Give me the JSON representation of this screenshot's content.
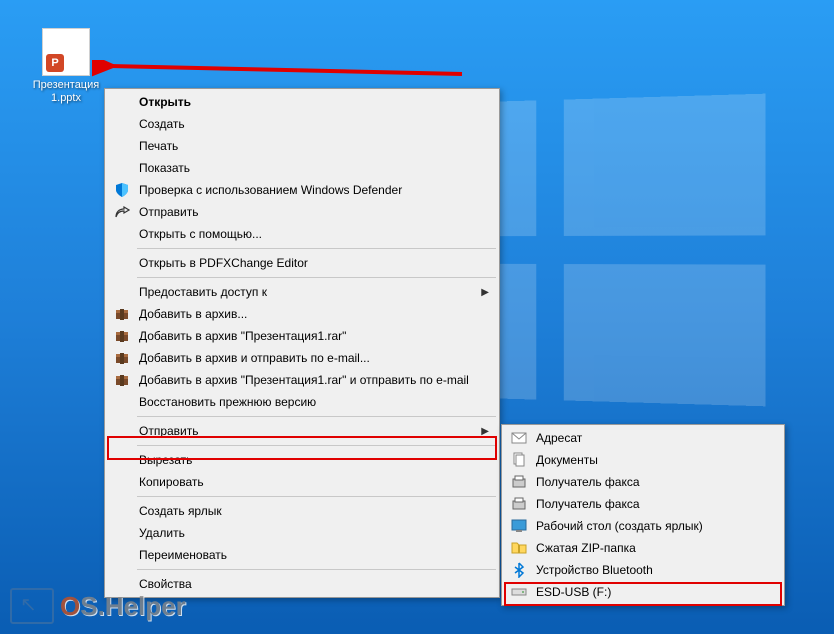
{
  "desktop": {
    "file_name": "Презентация1.pptx",
    "file_badge": "P"
  },
  "main_menu": {
    "open": "Открыть",
    "new": "Создать",
    "print": "Печать",
    "show": "Показать",
    "defender": "Проверка с использованием Windows Defender",
    "send": "Отправить",
    "open_with": "Открыть с помощью...",
    "pdf_editor": "Открыть в PDFXChange Editor",
    "share_access": "Предоставить доступ к",
    "rar_add": "Добавить в архив...",
    "rar_add_named": "Добавить в архив \"Презентация1.rar\"",
    "rar_email": "Добавить в архив и отправить по e-mail...",
    "rar_email_named": "Добавить в архив \"Презентация1.rar\" и отправить по e-mail",
    "restore": "Восстановить прежнюю версию",
    "send_to": "Отправить",
    "cut": "Вырезать",
    "copy": "Копировать",
    "shortcut": "Создать ярлык",
    "delete": "Удалить",
    "rename": "Переименовать",
    "properties": "Свойства"
  },
  "submenu": {
    "recipient": "Адресат",
    "documents": "Документы",
    "fax1": "Получатель факса",
    "fax2": "Получатель факса",
    "desktop_shortcut": "Рабочий стол (создать ярлык)",
    "zip": "Сжатая ZIP-папка",
    "bluetooth": "Устройство Bluetooth",
    "usb": "ESD-USB (F:)"
  },
  "watermark": "OS.Helper"
}
